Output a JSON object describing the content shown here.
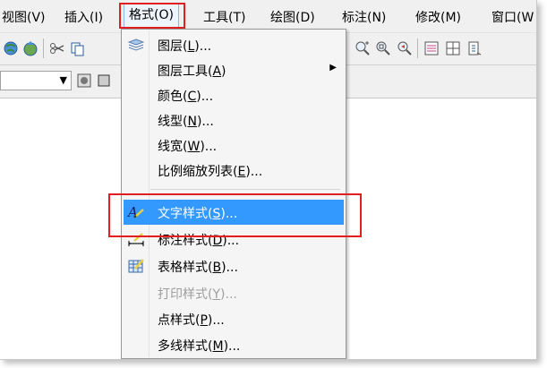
{
  "menubar": {
    "items": [
      {
        "label": "视图(V)"
      },
      {
        "label": "插入(I)"
      },
      {
        "label": "格式(O)"
      },
      {
        "label": "工具(T)"
      },
      {
        "label": "绘图(D)"
      },
      {
        "label": "标注(N)"
      },
      {
        "label": "修改(M)"
      },
      {
        "label": "窗口(W"
      }
    ]
  },
  "toolbar": {
    "icons": [
      "globe-icon",
      "globe-arrow-icon",
      "scissors-icon",
      "copy-icon",
      "zoom-realtime-icon",
      "zoom-window-icon",
      "zoom-previous-icon",
      "properties-icon",
      "design-center-icon",
      "tool-palette-icon"
    ]
  },
  "format_menu": {
    "items": [
      {
        "pre": "图层(",
        "key": "L",
        "post": ")...",
        "icon": "layers-icon"
      },
      {
        "pre": "图层工具(",
        "key": "A",
        "post": ")",
        "submenu": true
      },
      {
        "pre": "颜色(",
        "key": "C",
        "post": ")..."
      },
      {
        "pre": "线型(",
        "key": "N",
        "post": ")..."
      },
      {
        "pre": "线宽(",
        "key": "W",
        "post": ")..."
      },
      {
        "pre": "比例缩放列表(",
        "key": "E",
        "post": ")..."
      },
      {
        "pre": "文字样式(",
        "key": "S",
        "post": ")...",
        "icon": "text-style-icon",
        "selected": true
      },
      {
        "pre": "标注样式(",
        "key": "D",
        "post": ")...",
        "icon": "dimension-style-icon"
      },
      {
        "pre": "表格样式(",
        "key": "B",
        "post": ")...",
        "icon": "table-style-icon"
      },
      {
        "pre": "打印样式(",
        "key": "Y",
        "post": ")...",
        "disabled": true
      },
      {
        "pre": "点样式(",
        "key": "P",
        "post": ")..."
      },
      {
        "pre": "多线样式(",
        "key": "M",
        "post": ")..."
      }
    ]
  },
  "colors": {
    "highlight_box": "#e02020",
    "selection": "#3399ff",
    "menu_bg": "#f5f5f5"
  }
}
